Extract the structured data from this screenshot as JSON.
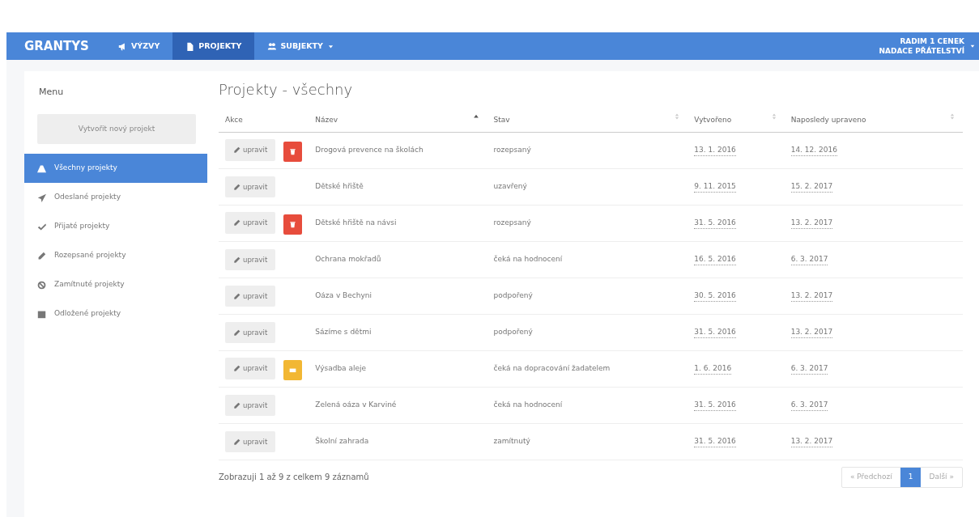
{
  "navbar": {
    "brand": "GRANTYS",
    "items": [
      {
        "label": "VÝZVY",
        "selected": false,
        "dropdown": false
      },
      {
        "label": "PROJEKTY",
        "selected": true,
        "dropdown": false
      },
      {
        "label": "SUBJEKTY",
        "selected": false,
        "dropdown": true
      }
    ],
    "user": {
      "name": "RADIM 1 CENEK",
      "organization": "NADACE PŘÁTELSTVÍ"
    }
  },
  "sidebar": {
    "title": "Menu",
    "create_button": "Vytvořit nový projekt",
    "items": [
      {
        "label": "Všechny projekty",
        "selected": true
      },
      {
        "label": "Odeslané projekty",
        "selected": false
      },
      {
        "label": "Přijaté projekty",
        "selected": false
      },
      {
        "label": "Rozepsané projekty",
        "selected": false
      },
      {
        "label": "Zamítnuté projekty",
        "selected": false
      },
      {
        "label": "Odložené projekty",
        "selected": false
      }
    ]
  },
  "page_title": "Projekty - všechny",
  "table": {
    "columns": [
      {
        "label": "Akce",
        "kind": "plain"
      },
      {
        "label": "Název",
        "kind": "sorted"
      },
      {
        "label": "Stav",
        "kind": "sortable"
      },
      {
        "label": "Vytvořeno",
        "kind": "sortable"
      },
      {
        "label": "Naposledy upraveno",
        "kind": "sortable"
      }
    ],
    "rows": [
      {
        "edit": "upravit",
        "kind": "delete",
        "name": "Drogová prevence na školách",
        "state": "rozepsaný",
        "created": "13. 1. 2016",
        "modified": "14. 12. 2016"
      },
      {
        "edit": "upravit",
        "kind": "plain",
        "name": "Dětské hřiště",
        "state": "uzavřený",
        "created": "9. 11. 2015",
        "modified": "15. 2. 2017"
      },
      {
        "edit": "upravit",
        "kind": "delete",
        "name": "Dětské hřiště na návsi",
        "state": "rozepsaný",
        "created": "31. 5. 2016",
        "modified": "13. 2. 2017"
      },
      {
        "edit": "upravit",
        "kind": "plain",
        "name": "Ochrana mokřadů",
        "state": "čeká na hodnocení",
        "created": "16. 5. 2016",
        "modified": "6. 3. 2017"
      },
      {
        "edit": "upravit",
        "kind": "plain",
        "name": "Oáza v Bechyni",
        "state": "podpořený",
        "created": "30. 5. 2016",
        "modified": "13. 2. 2017"
      },
      {
        "edit": "upravit",
        "kind": "plain",
        "name": "Sázíme s dětmi",
        "state": "podpořený",
        "created": "31. 5. 2016",
        "modified": "13. 2. 2017"
      },
      {
        "edit": "upravit",
        "kind": "message",
        "name": "Výsadba aleje",
        "state": "čeká na dopracování žadatelem",
        "created": "1. 6. 2016",
        "modified": "6. 3. 2017"
      },
      {
        "edit": "upravit",
        "kind": "plain",
        "name": "Zelená oáza v Karviné",
        "state": "čeká na hodnocení",
        "created": "31. 5. 2016",
        "modified": "6. 3. 2017"
      },
      {
        "edit": "upravit",
        "kind": "plain",
        "name": "Školní zahrada",
        "state": "zamítnutý",
        "created": "31. 5. 2016",
        "modified": "13. 2. 2017"
      }
    ]
  },
  "footer": {
    "info": "Zobrazuji 1 až 9 z celkem 9 záznamů",
    "pagination": [
      {
        "label": "« Předchozí",
        "selected": false,
        "disabled": true
      },
      {
        "label": "1",
        "selected": true,
        "disabled": false
      },
      {
        "label": "Další »",
        "selected": false,
        "disabled": true
      }
    ]
  }
}
